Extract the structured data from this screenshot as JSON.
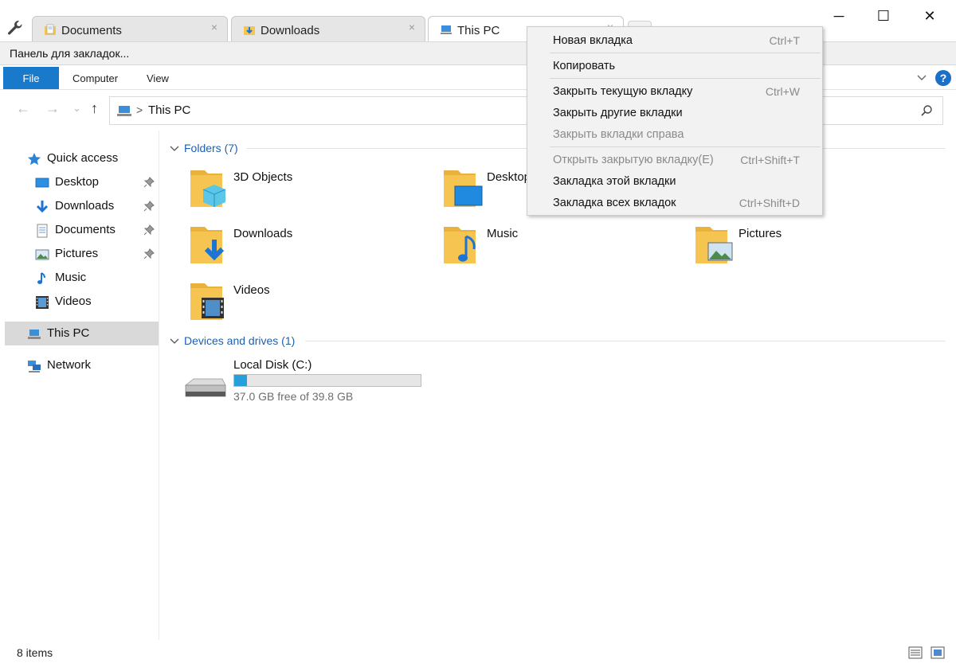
{
  "tabs": [
    {
      "label": "Documents",
      "close": "×",
      "icon": "documents-folder-icon"
    },
    {
      "label": "Downloads",
      "close": "×",
      "icon": "downloads-folder-icon"
    },
    {
      "label": "This PC",
      "close": "×",
      "icon": "this-pc-icon"
    }
  ],
  "window": {
    "minimize": "─",
    "maximize": "☐",
    "close": "✕"
  },
  "bookmark_bar": {
    "label": "Панель для закладок..."
  },
  "ribbon": {
    "file": "File",
    "computer": "Computer",
    "view": "View",
    "help": "?"
  },
  "nav": {
    "back": "←",
    "forward": "→",
    "recent": "⌄",
    "up": "↑"
  },
  "address": {
    "separator": ">",
    "crumb": "This PC"
  },
  "sidebar": {
    "quick_access": "Quick access",
    "items": [
      {
        "label": "Desktop",
        "pinned": true
      },
      {
        "label": "Downloads",
        "pinned": true
      },
      {
        "label": "Documents",
        "pinned": true
      },
      {
        "label": "Pictures",
        "pinned": true
      },
      {
        "label": "Music",
        "pinned": false
      },
      {
        "label": "Videos",
        "pinned": false
      }
    ],
    "this_pc": "This PC",
    "network": "Network"
  },
  "main": {
    "folders_header": "Folders (7)",
    "folders": [
      {
        "name": "3D Objects",
        "icon": "3d-objects-folder-icon"
      },
      {
        "name": "Desktop",
        "icon": "desktop-folder-icon"
      },
      {
        "name": "Downloads",
        "icon": "downloads-folder-icon"
      },
      {
        "name": "Music",
        "icon": "music-folder-icon"
      },
      {
        "name": "Pictures",
        "icon": "pictures-folder-icon"
      },
      {
        "name": "Videos",
        "icon": "videos-folder-icon"
      }
    ],
    "devices_header": "Devices and drives (1)",
    "drive": {
      "name": "Local Disk (C:)",
      "free_text": "37.0 GB free of 39.8 GB",
      "used_fraction": 0.07
    }
  },
  "status": {
    "items": "8 items"
  },
  "context_menu": {
    "items": [
      {
        "label": "Новая вкладка",
        "shortcut": "Ctrl+T",
        "disabled": false
      },
      {
        "label": "Копировать",
        "shortcut": "",
        "disabled": false
      },
      {
        "label": "Закрыть текущую вкладку",
        "shortcut": "Ctrl+W",
        "disabled": false
      },
      {
        "label": "Закрыть другие вкладки",
        "shortcut": "",
        "disabled": false
      },
      {
        "label": "Закрыть вкладки справа",
        "shortcut": "",
        "disabled": true
      },
      {
        "label": "Открыть закрытую вкладку(E)",
        "shortcut": "Ctrl+Shift+T",
        "disabled": true
      },
      {
        "label": "Закладка этой вкладки",
        "shortcut": "",
        "disabled": false
      },
      {
        "label": "Закладка всех вкладок",
        "shortcut": "Ctrl+Shift+D",
        "disabled": false
      }
    ]
  },
  "colors": {
    "accent": "#1979ca",
    "link": "#1e5fae",
    "folder": "#f5c451",
    "drive_fill": "#26a0da"
  }
}
